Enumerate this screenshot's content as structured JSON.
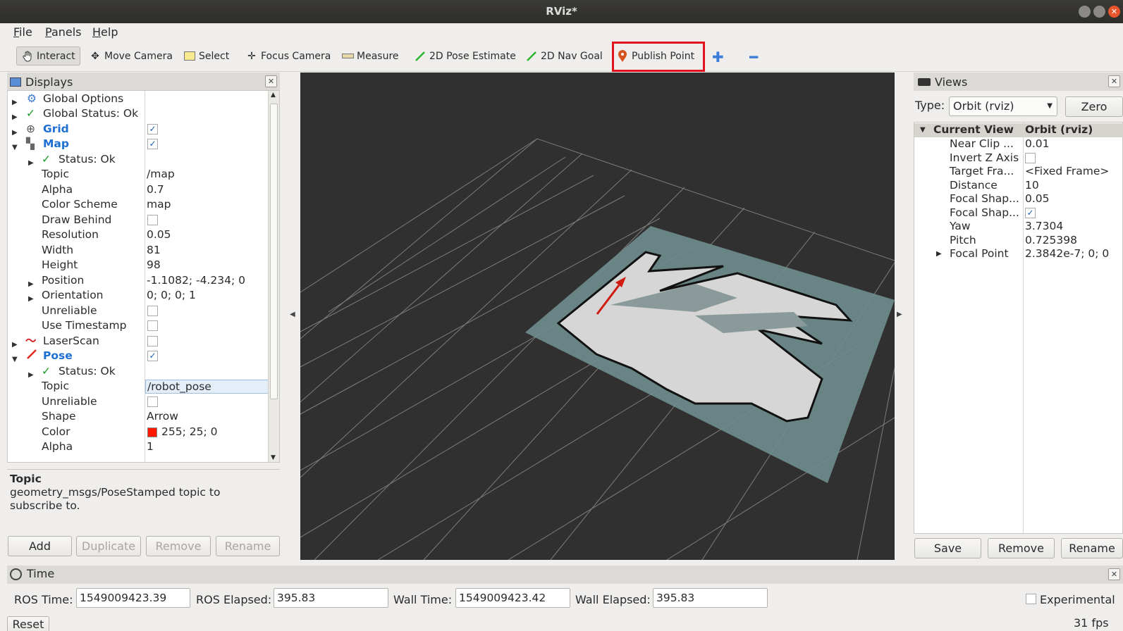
{
  "window": {
    "title": "RViz*"
  },
  "menu": [
    "File",
    "Panels",
    "Help"
  ],
  "toolbar": {
    "tools": [
      "Interact",
      "Move Camera",
      "Select",
      "Focus Camera",
      "Measure",
      "2D Pose Estimate",
      "2D Nav Goal",
      "Publish Point"
    ],
    "active_tool": "Interact",
    "highlighted_tool": "Publish Point"
  },
  "displays": {
    "title": "Displays",
    "rows": [
      {
        "name": "Global Options",
        "value": ""
      },
      {
        "name": "Global Status: Ok",
        "value": ""
      },
      {
        "name": "Grid",
        "checked": true
      },
      {
        "name": "Map",
        "checked": true
      },
      {
        "name": "Status: Ok",
        "value": ""
      },
      {
        "name": "Topic",
        "value": "/map"
      },
      {
        "name": "Alpha",
        "value": "0.7"
      },
      {
        "name": "Color Scheme",
        "value": "map"
      },
      {
        "name": "Draw Behind",
        "checked": false
      },
      {
        "name": "Resolution",
        "value": "0.05"
      },
      {
        "name": "Width",
        "value": "81"
      },
      {
        "name": "Height",
        "value": "98"
      },
      {
        "name": "Position",
        "value": "-1.1082; -4.234; 0"
      },
      {
        "name": "Orientation",
        "value": "0; 0; 0; 1"
      },
      {
        "name": "Unreliable",
        "checked": false
      },
      {
        "name": "Use Timestamp",
        "checked": false
      },
      {
        "name": "LaserScan",
        "checked": false
      },
      {
        "name": "Pose",
        "checked": true
      },
      {
        "name": "Status: Ok",
        "value": ""
      },
      {
        "name": "Topic",
        "value": "/robot_pose"
      },
      {
        "name": "Unreliable",
        "checked": false
      },
      {
        "name": "Shape",
        "value": "Arrow"
      },
      {
        "name": "Color",
        "value": "255; 25; 0",
        "swatch": "#ff1900"
      },
      {
        "name": "Alpha",
        "value": "1"
      }
    ],
    "description_title": "Topic",
    "description_text": "geometry_msgs/PoseStamped topic to subscribe to.",
    "buttons": [
      "Add",
      "Duplicate",
      "Remove",
      "Rename"
    ]
  },
  "views": {
    "title": "Views",
    "type_label": "Type:",
    "type_value": "Orbit (rviz)",
    "zero_label": "Zero",
    "header_name": "Current View",
    "header_value": "Orbit (rviz)",
    "rows": [
      {
        "name": "Near Clip ...",
        "value": "0.01"
      },
      {
        "name": "Invert Z Axis",
        "checked": false
      },
      {
        "name": "Target Fra...",
        "value": "<Fixed Frame>"
      },
      {
        "name": "Distance",
        "value": "10"
      },
      {
        "name": "Focal Shap...",
        "value": "0.05"
      },
      {
        "name": "Focal Shap...",
        "checked": true
      },
      {
        "name": "Yaw",
        "value": "3.7304"
      },
      {
        "name": "Pitch",
        "value": "0.725398"
      },
      {
        "name": "Focal Point",
        "value": "2.3842e-7; 0; 0"
      }
    ],
    "buttons": [
      "Save",
      "Remove",
      "Rename"
    ]
  },
  "time": {
    "title": "Time",
    "ros_time_label": "ROS Time:",
    "ros_time": "1549009423.39",
    "ros_elapsed_label": "ROS Elapsed:",
    "ros_elapsed": "395.83",
    "wall_time_label": "Wall Time:",
    "wall_time": "1549009423.42",
    "wall_elapsed_label": "Wall Elapsed:",
    "wall_elapsed": "395.83",
    "experimental_label": "Experimental",
    "reset_label": "Reset",
    "fps": "31 fps"
  },
  "colors": {
    "accent": "#1e6fd2",
    "highlight_box": "#e3111b",
    "viewport_bg": "#303030",
    "map_fill": "#6f8c8c",
    "pose_arrow": "#ff1900"
  }
}
